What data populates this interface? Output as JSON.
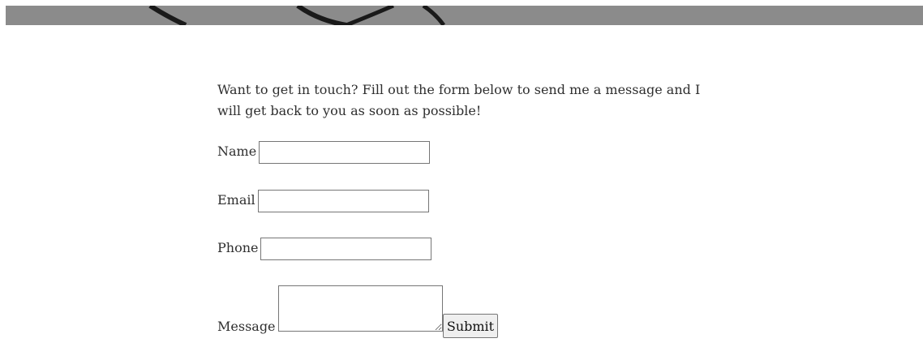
{
  "intro_text": "Want to get in touch? Fill out the form below to send me a message and I will get back to you as soon as possible!",
  "form": {
    "name_label": "Name",
    "name_value": "",
    "email_label": "Email",
    "email_value": "",
    "phone_label": "Phone",
    "phone_value": "",
    "message_label": "Message",
    "message_value": "",
    "submit_label": "Submit"
  }
}
